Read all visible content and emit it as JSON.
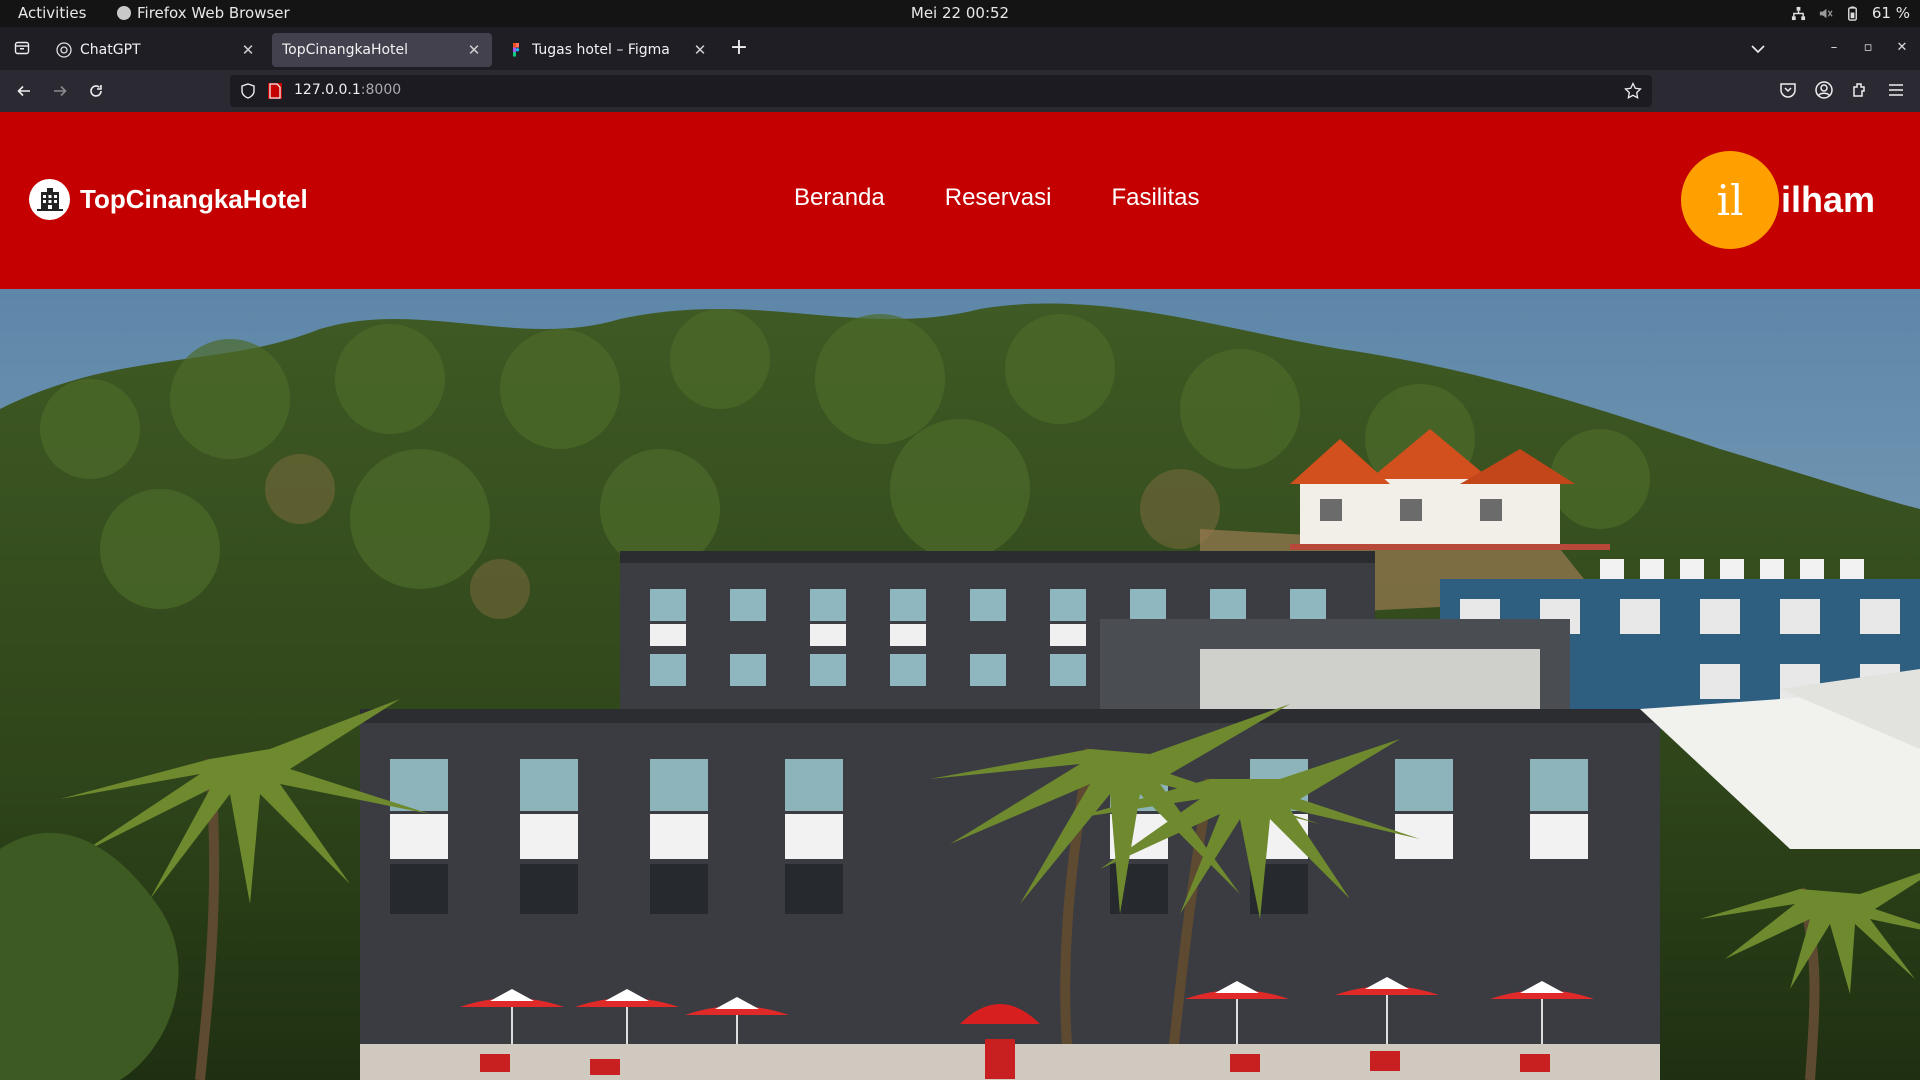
{
  "system_bar": {
    "activities": "Activities",
    "app_name": "Firefox Web Browser",
    "clock": "Mei 22  00:52",
    "battery": "61 %"
  },
  "browser": {
    "tabs": [
      {
        "title": "ChatGPT",
        "favicon": "chatgpt-icon",
        "active": false
      },
      {
        "title": "TopCinangkaHotel",
        "favicon": "",
        "active": true
      },
      {
        "title": "Tugas hotel – Figma",
        "favicon": "figma-icon",
        "active": false
      }
    ],
    "url_host": "127.0.0.1",
    "url_port": ":8000"
  },
  "site": {
    "brand_name": "TopCinangkaHotel",
    "nav": [
      "Beranda",
      "Reservasi",
      "Fasilitas"
    ],
    "user": {
      "initials": "il",
      "name": "ilham",
      "avatar_color": "#ffa000"
    },
    "header_color": "#c40000",
    "hero_image": "hotel-building-with-palm-trees-and-red-umbrellas"
  }
}
